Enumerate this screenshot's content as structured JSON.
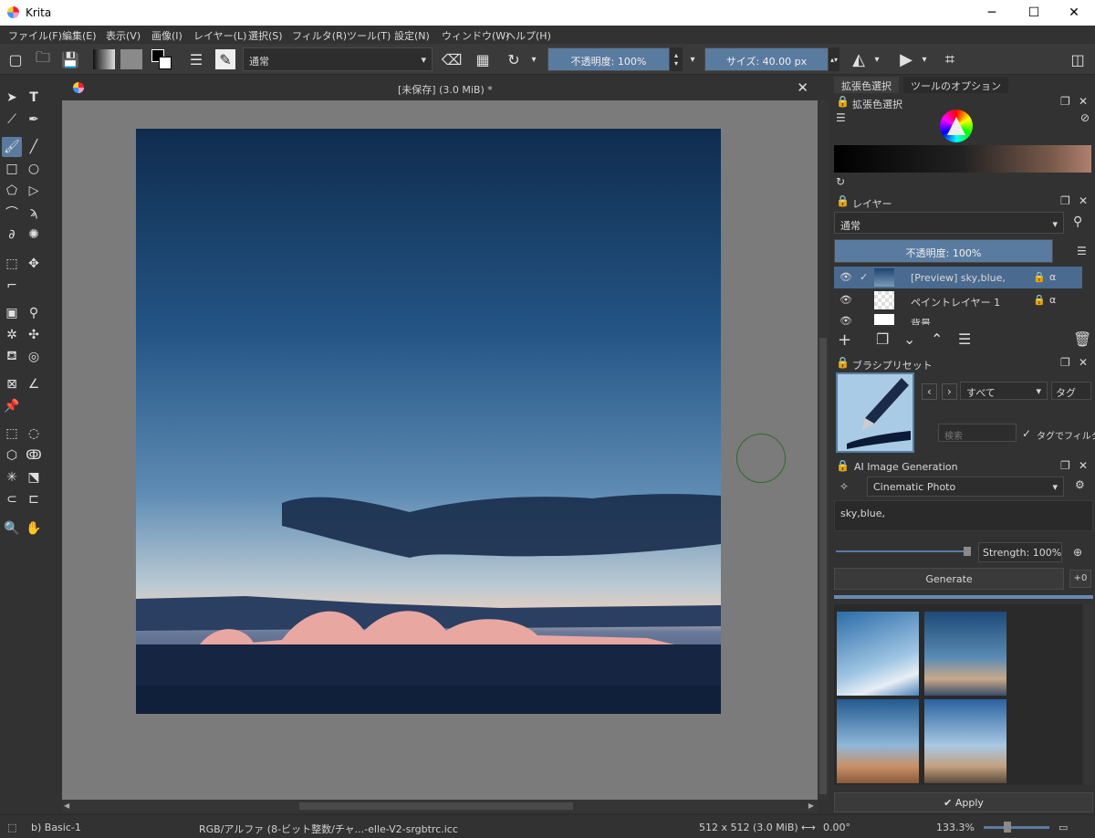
{
  "window": {
    "app_name": "Krita",
    "minimize": "─",
    "maximize": "☐",
    "close": "✕"
  },
  "menubar": {
    "items": [
      "ファイル(F)",
      "編集(E)",
      "表示(V)",
      "画像(I)",
      "レイヤー(L)",
      "選択(S)",
      "フィルタ(R)",
      "ツール(T)",
      "設定(N)",
      "ウィンドウ(W)",
      "ヘルプ(H)"
    ]
  },
  "toolbar": {
    "blend_mode": "通常",
    "opacity": "不透明度: 100%",
    "size": "サイズ: 40.00 px"
  },
  "canvas": {
    "tab_title": "[未保存]  (3.0 MiB) *",
    "close": "✕"
  },
  "dock": {
    "tabs": [
      "拡張色選択",
      "ツールのオプション"
    ],
    "color_selector_title": "拡張色選択",
    "layers": {
      "title": "レイヤー",
      "blend_mode": "通常",
      "opacity": "不透明度:  100%",
      "rows": [
        {
          "name": "[Preview] sky,blue,",
          "visible": true,
          "checked": true
        },
        {
          "name": "ペイントレイヤー 1",
          "visible": true,
          "checked": false
        },
        {
          "name": "背景",
          "visible": true,
          "checked": false
        }
      ]
    },
    "brush_presets": {
      "title": "ブラシプリセット",
      "filter": "すべて",
      "tag": "タグ",
      "search_placeholder": "検索",
      "tag_filter": "タグでフィルタ"
    },
    "ai": {
      "title": "AI Image Generation",
      "style": "Cinematic Photo",
      "prompt": "sky,blue,",
      "strength": "Strength: 100%",
      "generate": "Generate",
      "plus": "+0",
      "apply": "Apply",
      "apply_icon": "✔"
    }
  },
  "status": {
    "brush": "b) Basic-1",
    "color_profile": "RGB/アルファ (8-ビット整数/チャ...-elle-V2-srgbtrc.icc",
    "image_size": "512 x 512 (3.0 MiB)",
    "rotation": "0.00°",
    "zoom": "133.3%"
  },
  "colors": {
    "accent": "#5a7ba0",
    "canvas_bg": "#7b7b7b",
    "panel_bg": "#323232"
  }
}
